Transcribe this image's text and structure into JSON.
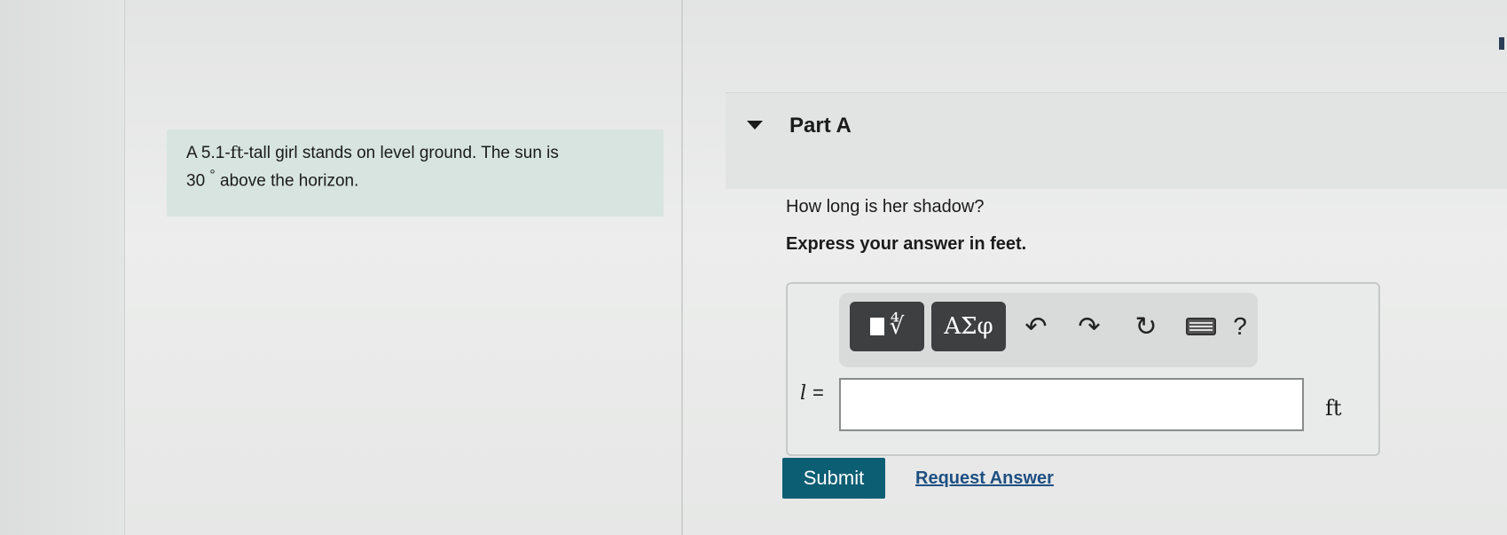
{
  "problem": {
    "line1_prefix": "A 5.1-",
    "line1_unit": "ft",
    "line1_suffix": "-tall girl stands on level ground. The sun is",
    "line2_value": "30",
    "line2_degree": "°",
    "line2_suffix": "above the horizon."
  },
  "part": {
    "title": "Part A",
    "question": "How long is her shadow?",
    "instructions": "Express your answer in feet."
  },
  "toolbar": {
    "symbols_label": "ΑΣφ",
    "help_label": "?",
    "templates_root": "∜"
  },
  "answer": {
    "variable": "l",
    "equals": "=",
    "value": "",
    "unit": "ft"
  },
  "actions": {
    "submit_label": "Submit",
    "request_answer_label": "Request Answer"
  },
  "colors": {
    "problem_bg": "#d7e4e0",
    "submit_bg": "#0c5e73",
    "link": "#1f4f82",
    "toolbar_button": "#3e3f40"
  }
}
